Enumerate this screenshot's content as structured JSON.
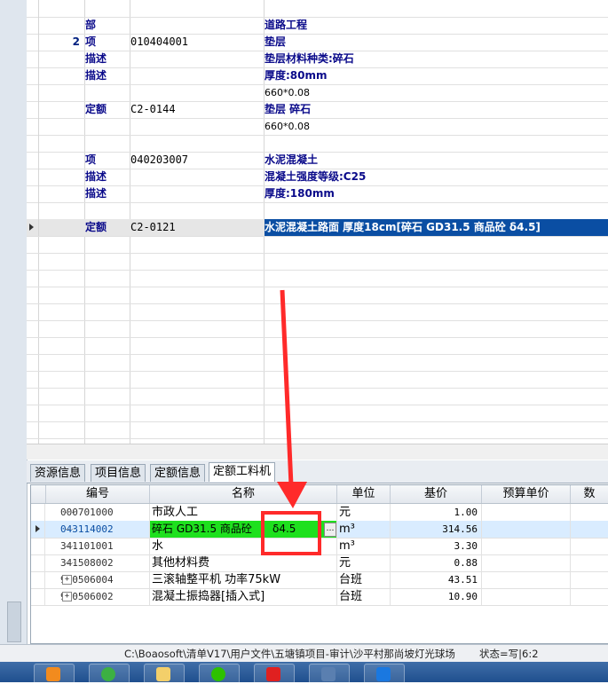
{
  "upper_grid": {
    "rows": [
      {
        "num": "",
        "type": "",
        "code": "",
        "name": "",
        "style": "plain"
      },
      {
        "num": "",
        "type": "部",
        "code": "",
        "name": "道路工程",
        "style": "plain"
      },
      {
        "num": "2",
        "type": "项",
        "code": "010404001",
        "name": "垫层",
        "style": "plain"
      },
      {
        "num": "",
        "type": "描述",
        "code": "",
        "name": "垫层材料种类:碎石",
        "style": "plain"
      },
      {
        "num": "",
        "type": "描述",
        "code": "",
        "name": "厚度:80mm",
        "style": "plain"
      },
      {
        "num": "",
        "type": "",
        "code": "",
        "name": "660*0.08",
        "style": "small"
      },
      {
        "num": "",
        "type": "定额",
        "code": "C2-0144",
        "name": "垫层 碎石",
        "style": "plain"
      },
      {
        "num": "",
        "type": "",
        "code": "",
        "name": "660*0.08",
        "style": "small"
      },
      {
        "num": "",
        "type": "",
        "code": "",
        "name": "",
        "style": "plain"
      },
      {
        "num": "",
        "type": "项",
        "code": "040203007",
        "name": "水泥混凝土",
        "style": "plain"
      },
      {
        "num": "",
        "type": "描述",
        "code": "",
        "name": "混凝土强度等级:C25",
        "style": "plain"
      },
      {
        "num": "",
        "type": "描述",
        "code": "",
        "name": "厚度:180mm",
        "style": "plain"
      },
      {
        "num": "",
        "type": "",
        "code": "",
        "name": "",
        "style": "plain"
      },
      {
        "num": "",
        "type": "定额",
        "code": "C2-0121",
        "name": "水泥混凝土路面 厚度18cm[碎石 GD31.5 商品砼 δ4.5]",
        "style": "active"
      }
    ]
  },
  "tabs": [
    {
      "label": "资源信息",
      "active": false
    },
    {
      "label": "项目信息",
      "active": false
    },
    {
      "label": "定额信息",
      "active": false
    },
    {
      "label": "定额工料机",
      "active": true
    }
  ],
  "lower_grid": {
    "headers": {
      "code": "编号",
      "name": "名称",
      "unit": "单位",
      "base": "基价",
      "budget": "预算单价",
      "more": "数"
    },
    "rows": [
      {
        "code": "000701000",
        "name": "市政人工",
        "unit": "元",
        "base": "1.00",
        "tree": "line",
        "active": false
      },
      {
        "code": "043114002",
        "name": "碎石 GD31.5 商品砼",
        "name_suffix": "δ4.5",
        "unit": "m³",
        "base": "314.56",
        "tree": "line",
        "active": true
      },
      {
        "code": "341101001",
        "name": "水",
        "unit": "m³",
        "base": "3.30",
        "tree": "line",
        "active": false
      },
      {
        "code": "341508002",
        "name": "其他材料费",
        "unit": "元",
        "base": "0.88",
        "tree": "line",
        "active": false
      },
      {
        "code": "990506004",
        "name": "三滚轴整平机 功率75kW",
        "unit": "台班",
        "base": "43.51",
        "tree": "plus",
        "active": false
      },
      {
        "code": "990506002",
        "name": "混凝土振捣器[插入式]",
        "unit": "台班",
        "base": "10.90",
        "tree": "plus",
        "active": false
      }
    ]
  },
  "status": {
    "path": "C:\\Boaosoft\\清单V17\\用户文件\\五塘镇项目-审计\\沙平村那尚坡灯光球场",
    "state": "状态=写|6:2"
  },
  "colors": {
    "highlight_green": "#1ee01e",
    "selection_blue": "#0a4ea3",
    "annotation_red": "#ff2a2a"
  },
  "taskbar_icons": [
    "media-player-icon",
    "browser-icon",
    "folder-icon",
    "wechat-icon",
    "app-red-icon",
    "calc-icon",
    "wps-icon"
  ]
}
